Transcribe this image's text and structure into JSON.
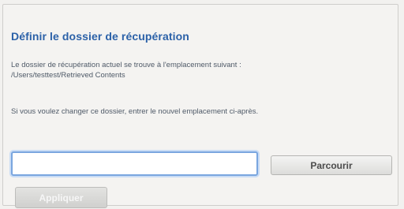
{
  "dialog": {
    "title": "Définir le dossier de récupération",
    "current_location_line1": "Le dossier de récupération actuel se trouve à l'emplacement suivant :",
    "current_location_line2": "/Users/testtest/Retrieved Contents",
    "instructions": "Si vous voulez changer ce dossier, entrer le nouvel emplacement ci-après."
  },
  "path_field": {
    "value": "",
    "placeholder": ""
  },
  "buttons": {
    "browse_label": "Parcourir",
    "apply_label": "Appliquer"
  },
  "colors": {
    "title": "#2b61a8",
    "body_text": "#4f5a68",
    "focus_ring": "#7aa6df"
  }
}
